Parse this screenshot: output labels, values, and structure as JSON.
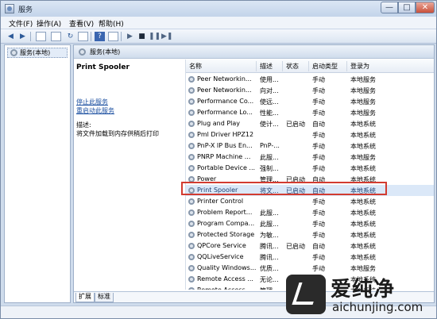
{
  "window": {
    "title": "服务",
    "min_glyph": "—",
    "max_glyph": "□",
    "close_glyph": "✕"
  },
  "menu": [
    "文件(F)",
    "操作(A)",
    "查看(V)",
    "帮助(H)"
  ],
  "tree": {
    "root": "服务(本地)"
  },
  "panel": {
    "header": "服务(本地)"
  },
  "detail": {
    "service_name": "Print Spooler",
    "stop_link": "停止此服务",
    "restart_link": "重启动此服务",
    "desc_label": "描述:",
    "desc_text": "将文件加载到内存供稍后打印"
  },
  "table": {
    "columns": [
      "名称",
      "描述",
      "状态",
      "启动类型",
      "登录为"
    ],
    "rows": [
      {
        "name": "Peer Networkin...",
        "desc": "使用...",
        "status": "",
        "start": "手动",
        "logon": "本地服务"
      },
      {
        "name": "Peer Networkin...",
        "desc": "向对...",
        "status": "",
        "start": "手动",
        "logon": "本地服务"
      },
      {
        "name": "Performance Co...",
        "desc": "使远...",
        "status": "",
        "start": "手动",
        "logon": "本地服务"
      },
      {
        "name": "Performance Lo...",
        "desc": "性能...",
        "status": "",
        "start": "手动",
        "logon": "本地服务"
      },
      {
        "name": "Plug and Play",
        "desc": "使计...",
        "status": "已启动",
        "start": "自动",
        "logon": "本地系统"
      },
      {
        "name": "Pml Driver HPZ12",
        "desc": "",
        "status": "",
        "start": "手动",
        "logon": "本地系统"
      },
      {
        "name": "PnP-X IP Bus En...",
        "desc": "PnP-...",
        "status": "",
        "start": "手动",
        "logon": "本地系统"
      },
      {
        "name": "PNRP Machine ...",
        "desc": "此服...",
        "status": "",
        "start": "手动",
        "logon": "本地服务"
      },
      {
        "name": "Portable Device ...",
        "desc": "强制...",
        "status": "",
        "start": "手动",
        "logon": "本地系统"
      },
      {
        "name": "Power",
        "desc": "管理...",
        "status": "已启动",
        "start": "自动",
        "logon": "本地系统"
      },
      {
        "name": "Print Spooler",
        "desc": "将文...",
        "status": "已启动",
        "start": "自动",
        "logon": "本地系统",
        "selected": true
      },
      {
        "name": "Printer Control",
        "desc": "",
        "status": "",
        "start": "手动",
        "logon": "本地系统"
      },
      {
        "name": "Problem Report...",
        "desc": "此服...",
        "status": "",
        "start": "手动",
        "logon": "本地系统"
      },
      {
        "name": "Program Compa...",
        "desc": "此服...",
        "status": "",
        "start": "手动",
        "logon": "本地系统"
      },
      {
        "name": "Protected Storage",
        "desc": "为敏...",
        "status": "",
        "start": "手动",
        "logon": "本地系统"
      },
      {
        "name": "QPCore Service",
        "desc": "腾讯...",
        "status": "已启动",
        "start": "自动",
        "logon": "本地系统"
      },
      {
        "name": "QQLiveService",
        "desc": "腾讯...",
        "status": "",
        "start": "手动",
        "logon": "本地系统"
      },
      {
        "name": "Quality Windows...",
        "desc": "优质...",
        "status": "",
        "start": "手动",
        "logon": "本地服务"
      },
      {
        "name": "Remote Access ...",
        "desc": "无论...",
        "status": "",
        "start": "手动",
        "logon": "本地系统"
      },
      {
        "name": "Remote Access ...",
        "desc": "管理...",
        "status": "",
        "start": "手动",
        "logon": "本地系统"
      }
    ]
  },
  "tabs": [
    "扩展",
    "标准"
  ],
  "watermark": {
    "cn": "爱纯净",
    "en": "aichunjing.com",
    "small": "爱纯净"
  }
}
